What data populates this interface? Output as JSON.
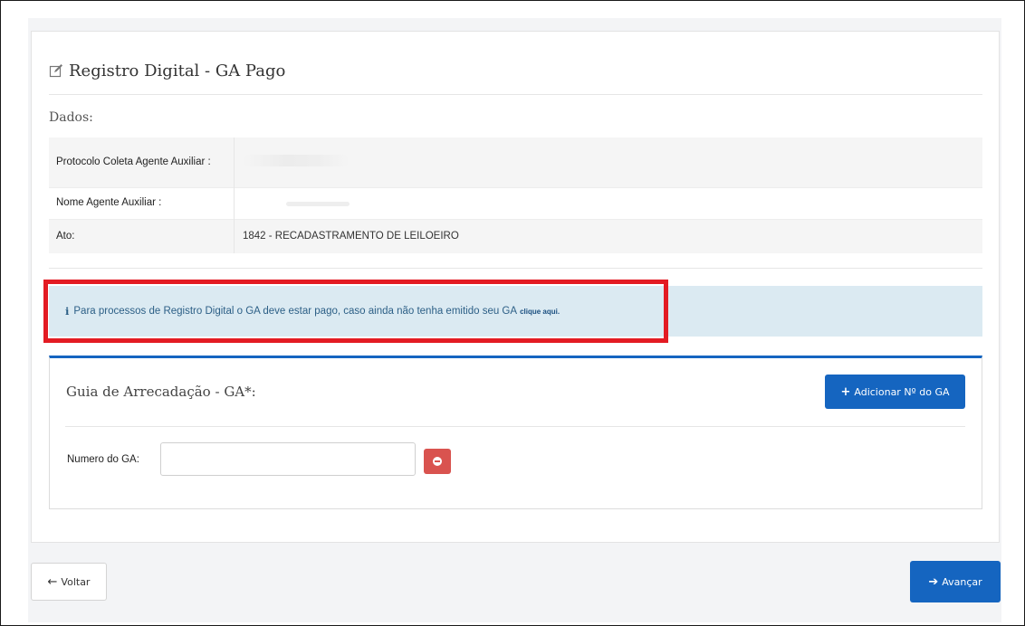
{
  "page": {
    "title": "Registro Digital - GA Pago",
    "title_icon": "edit-icon",
    "section_label": "Dados:"
  },
  "info_table": {
    "rows": [
      {
        "label": "Protocolo Coleta Agente Auxiliar :",
        "value": ""
      },
      {
        "label": "Nome Agente Auxiliar :",
        "value": ""
      },
      {
        "label": "Ato:",
        "value": "1842 - RECADASTRAMENTO DE LEILOEIRO"
      }
    ]
  },
  "alert": {
    "icon": "info-icon",
    "text": "Para processos de Registro Digital o GA deve estar pago, caso ainda não tenha emitido seu GA",
    "link_text": "clique aqui."
  },
  "ga_panel": {
    "title": "Guia de Arrecadação - GA*:",
    "add_button_label": "Adicionar Nº do GA",
    "field_label": "Numero do GA:",
    "field_value": "",
    "field_placeholder": ""
  },
  "footer": {
    "back_label": "Voltar",
    "next_label": "Avançar"
  },
  "colors": {
    "primary": "#1565c0",
    "danger": "#d9534f",
    "highlight": "#e31b23",
    "alert_bg": "#dbeaf2"
  }
}
